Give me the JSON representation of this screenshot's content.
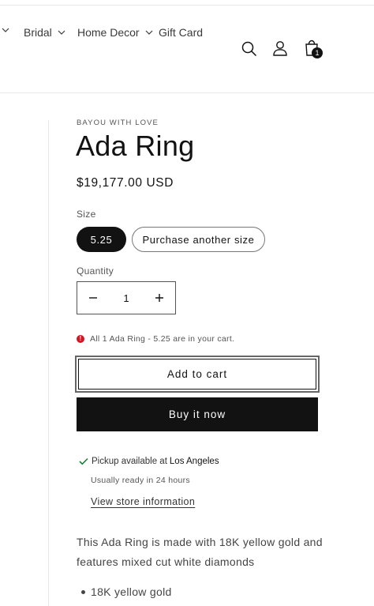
{
  "nav": {
    "items": [
      {
        "label": ""
      },
      {
        "label": "Bridal"
      },
      {
        "label": "Home Decor"
      },
      {
        "label": "Gift Card"
      }
    ]
  },
  "header": {
    "icons": [
      "search-icon",
      "account-icon",
      "cart-icon"
    ],
    "cart_count": "1"
  },
  "product": {
    "vendor": "BAYOU WITH LOVE",
    "title": "Ada Ring",
    "price": "$19,177.00 USD",
    "size_label": "Size",
    "sizes": [
      {
        "label": "5.25",
        "selected": true
      },
      {
        "label": "Purchase another size",
        "selected": false
      }
    ],
    "quantity_label": "Quantity",
    "quantity_value": "1",
    "error_message": "All 1 Ada Ring - 5.25 are in your cart.",
    "add_to_cart_label": "Add to cart",
    "buy_now_label": "Buy it now",
    "pickup_text": "Pickup available at",
    "pickup_location": "Los Angeles",
    "ready_text": "Usually ready in 24 hours",
    "store_link": "View store information",
    "description": "This Ada Ring is made with 18K yellow gold and features mixed cut white diamonds",
    "bullets": [
      "18K yellow gold"
    ]
  },
  "colors": {
    "primary": "#121212",
    "error": "#d41423",
    "success": "#1a7f37"
  }
}
